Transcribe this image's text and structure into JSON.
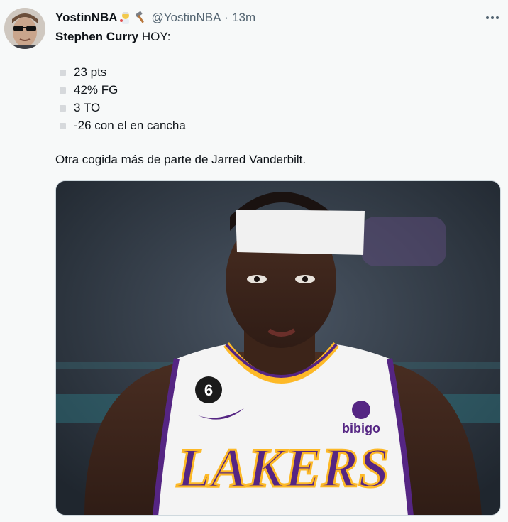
{
  "author": {
    "display_name": "YostinNBA",
    "handle": "@YostinNBA",
    "separator": "·",
    "time": "13m"
  },
  "icons": {
    "emoji_1": "woman-scientist-emoji",
    "emoji_2": "hammer-emoji",
    "more": "more-dots-icon"
  },
  "tweet": {
    "headline_name": "Stephen Curry",
    "headline_rest": " HOY:",
    "stats": [
      "23 pts",
      "42% FG",
      "3 TO",
      "-26 con el en cancha"
    ],
    "closing": "Otra cogida más de parte de Jarred Vanderbilt."
  },
  "media": {
    "jersey_text": "LAKERS",
    "jersey_number": "6",
    "sponsor": "bibigo"
  },
  "colors": {
    "lakers_purple": "#552583",
    "lakers_gold": "#fdb927"
  }
}
